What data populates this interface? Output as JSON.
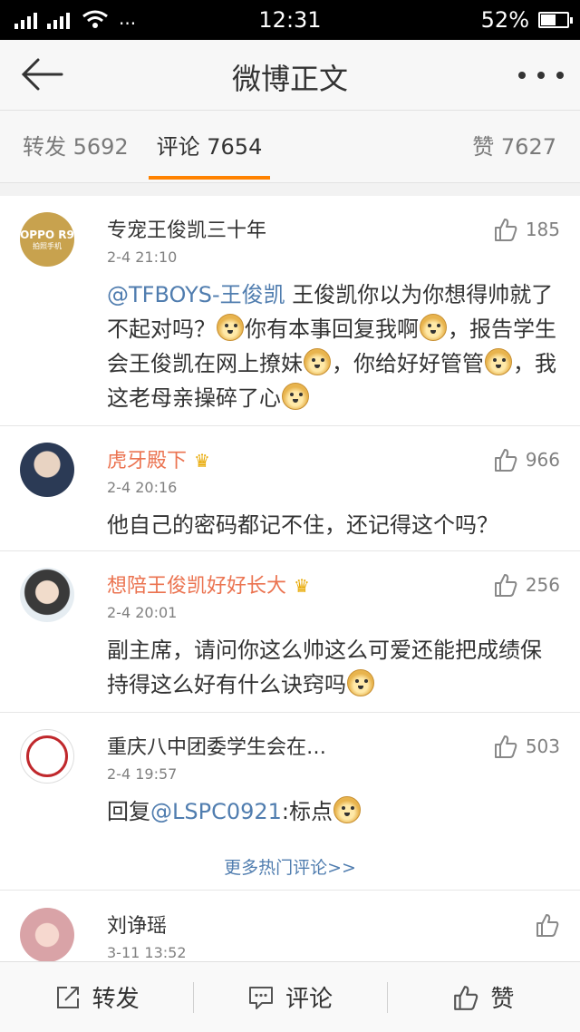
{
  "status_bar": {
    "time": "12:31",
    "battery": "52%",
    "battery_level": 0.52
  },
  "nav": {
    "title": "微博正文"
  },
  "tabs": {
    "repost": "转发 5692",
    "comment": "评论 7654",
    "like": "赞 7627"
  },
  "comments": [
    {
      "user": "专宠王俊凯三十年",
      "avatar_text": "OPPO R9",
      "avatar_sub": "拍照手机",
      "time": "2-4 21:10",
      "likes": "185",
      "mention": "@TFBOYS-王俊凯",
      "text_1": " 王俊凯你以为你想得帅就了不起对吗？",
      "text_2": "你有本事回复我啊",
      "text_3": "，报告学生会王俊凯在网上撩妹",
      "text_4": "，你给好好管管",
      "text_5": "，我这老母亲操碎了心"
    },
    {
      "user": "虎牙殿下",
      "time": "2-4 20:16",
      "likes": "966",
      "text": "他自己的密码都记不住，还记得这个吗？"
    },
    {
      "user": "想陪王俊凯好好长大",
      "time": "2-4 20:01",
      "likes": "256",
      "text": "副主席，请问你这么帅这么可爱还能把成绩保持得这么好有什么诀窍吗"
    },
    {
      "user": "重庆八中团委学生会在…",
      "time": "2-4 19:57",
      "likes": "503",
      "reply_prefix": "回复",
      "mention": "@LSPC0921",
      "text": ":标点"
    },
    {
      "user": "刘诤瑶",
      "time": "3-11 13:52"
    }
  ],
  "more_hot": "更多热门评论>>",
  "bottom_bar": {
    "repost": "转发",
    "comment": "评论",
    "like": "赞"
  },
  "colors": {
    "accent": "#ff8200",
    "link": "#507daf",
    "vip_name": "#eb7350"
  }
}
